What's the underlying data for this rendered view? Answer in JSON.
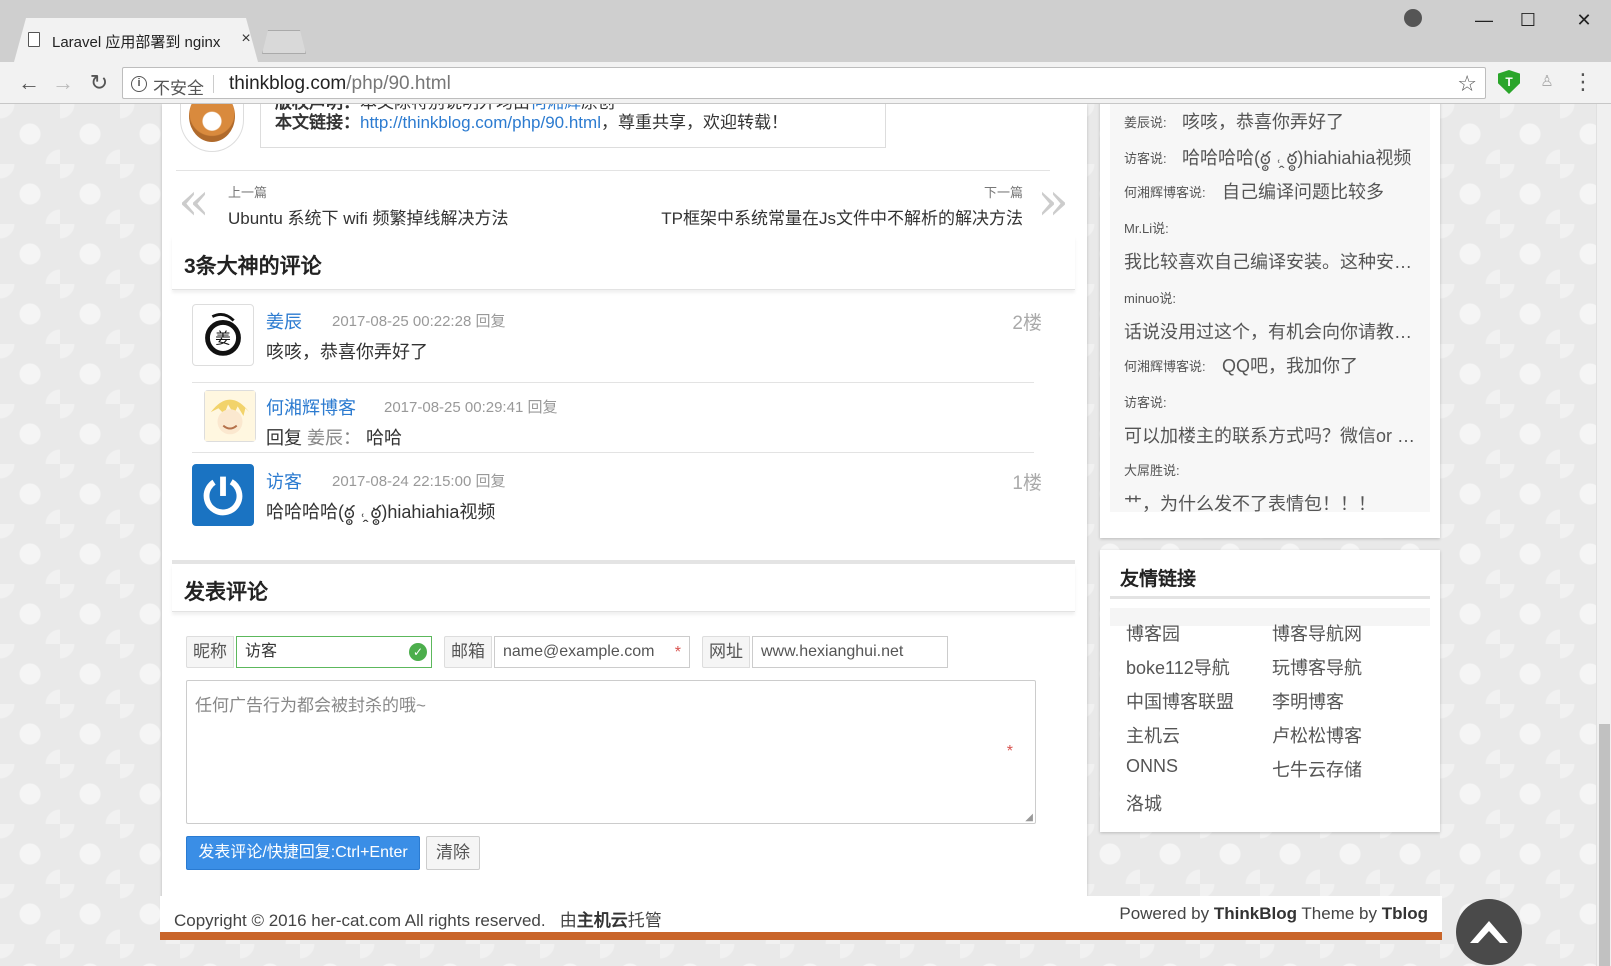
{
  "browser": {
    "tab_title": "Laravel 应用部署到 nginx",
    "tab_close": "×",
    "insecure_label": "不安全",
    "url_host": "thinkblog.com",
    "url_path": "/php/90.html",
    "win_minimize": "—",
    "win_maximize": "☐",
    "win_close": "✕"
  },
  "article": {
    "copyright_label": "版权声明：",
    "copyright_text": "本文除特别说明外均由",
    "copyright_author": "何湘辉",
    "copyright_suffix": "原创",
    "link_label": "本文链接：",
    "link_url": "http://thinkblog.com/php/90.html",
    "link_suffix": "，尊重共享，欢迎转载！"
  },
  "prev_next": {
    "prev_label": "上一篇",
    "prev_title": "Ubuntu 系统下 wifi 频繁掉线解决方法",
    "next_label": "下一篇",
    "next_title": "TP框架中系统常量在Js文件中不解析的解决方法",
    "prev_arrow": "«",
    "next_arrow": "»"
  },
  "comments": {
    "heading": "3条大神的评论",
    "items": [
      {
        "name": "姜辰",
        "time": "2017-08-25 00:22:28",
        "reply": "回复",
        "floor": "2楼",
        "text": "咳咳，恭喜你弄好了"
      },
      {
        "name": "何湘辉博客",
        "time": "2017-08-25 00:29:41",
        "reply": "回复",
        "text_prefix": "回复",
        "ref": "姜辰：",
        "text": "哈哈"
      },
      {
        "name": "访客",
        "time": "2017-08-24 22:15:00",
        "reply": "回复",
        "floor": "1楼",
        "text": "哈哈哈哈(ఠ్ఠ ˓̭ ఠ్ఠ)hiahiahia视频"
      }
    ]
  },
  "form": {
    "heading": "发表评论",
    "nick_label": "昵称",
    "nick_value": "访客",
    "email_label": "邮箱",
    "email_placeholder": "name@example.com",
    "site_label": "网址",
    "site_placeholder": "www.hexianghui.net",
    "textarea_placeholder": "任何广告行为都会被封杀的哦~",
    "required": "*",
    "submit_label": "发表评论/快捷回复:Ctrl+Enter",
    "clear_label": "清除"
  },
  "recent_comments": [
    {
      "who": "姜辰说:",
      "text": "咳咳，恭喜你弄好了"
    },
    {
      "who": "访客说:",
      "text": "哈哈哈哈(ఠ్ఠ ˓̭ ఠ్ఠ)hiahiahia视频"
    },
    {
      "who": "何湘辉博客说:",
      "text": "自己编译问题比较多"
    },
    {
      "who": "Mr.Li说:",
      "text": "我比较喜欢自己编译安装。这种安…"
    },
    {
      "who": "minuo说:",
      "text": "话说没用过这个，有机会向你请教…"
    },
    {
      "who": "何湘辉博客说:",
      "text": "QQ吧，我加你了"
    },
    {
      "who": "访客说:",
      "text": "可以加楼主的联系方式吗？微信or …"
    },
    {
      "who": "大屌胜说:",
      "text": "艹，为什么发不了表情包！！！"
    }
  ],
  "links": {
    "title": "友情链接",
    "items": [
      "博客园",
      "博客导航网",
      "boke112导航",
      "玩博客导航",
      "中国博客联盟",
      "李明博客",
      "主机云",
      "卢松松博客",
      "ONNS",
      "七牛云存储",
      "洛城"
    ]
  },
  "footer": {
    "left": "Copyright © 2016 her-cat.com All rights reserved.",
    "host_prefix": "由",
    "host_name": "主机云",
    "host_suffix": "托管",
    "powered": "Powered by",
    "powered_name": "ThinkBlog",
    "theme": "Theme by",
    "theme_name": "Tblog"
  },
  "colors": {
    "link_blue": "#2c7bd0",
    "primary_button": "#3a8ee6",
    "footer_accent": "#c9652a",
    "valid_green": "#4cae4c"
  }
}
